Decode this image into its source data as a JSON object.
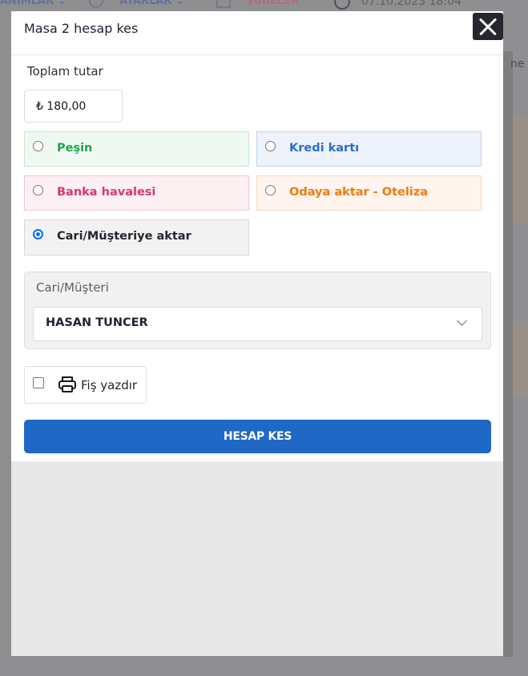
{
  "background": {
    "nav_tanimlar": "ANIMLAR ⌄",
    "nav_ayarlar": "AYARLAR ⌄",
    "nav_subeler": "ŞUBELER",
    "datetime": "07.10.2023 18:04",
    "side_text": "ne"
  },
  "modal": {
    "title": "Masa 2 hesap kes",
    "close_icon": "close-icon",
    "total_label": "Toplam tutar",
    "total_amount": "₺ 180,00",
    "payment_options": [
      {
        "label": "Peşin",
        "selected": false,
        "color": "#1fa34b"
      },
      {
        "label": "Kredi kartı",
        "selected": false,
        "color": "#2b6ec8"
      },
      {
        "label": "Banka havalesi",
        "selected": false,
        "color": "#d63a6e"
      },
      {
        "label": "Odaya aktar - Oteliza",
        "selected": false,
        "color": "#f07a12"
      },
      {
        "label": "Cari/Müşteriye aktar",
        "selected": true,
        "color": "#23262e"
      }
    ],
    "customer": {
      "label": "Cari/Müşteri",
      "selected_value": "HASAN TUNCER"
    },
    "print_receipt": {
      "label": "Fiş yazdır",
      "checked": false,
      "icon": "printer-icon"
    },
    "submit_label": "HESAP KES",
    "accent_color": "#1f68c5"
  }
}
